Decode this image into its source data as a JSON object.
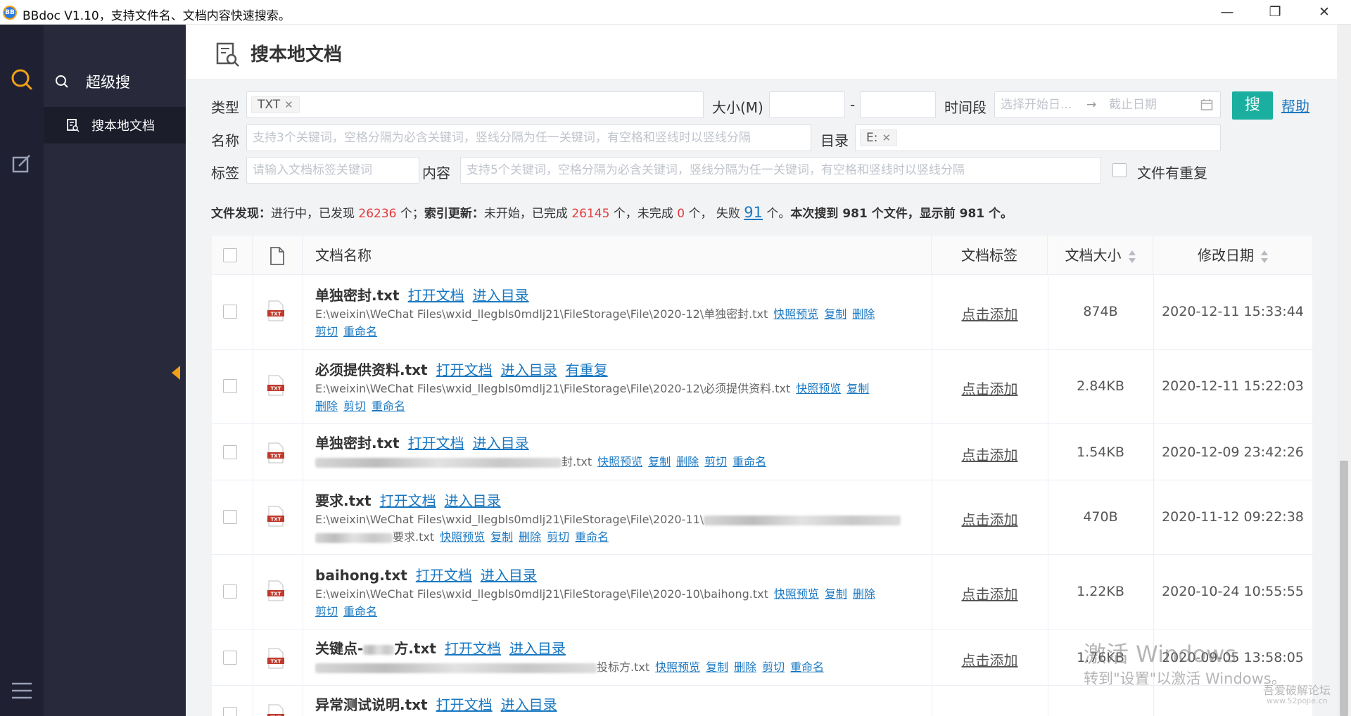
{
  "window": {
    "logo": "BB",
    "title": "BBdoc V1.10，支持文件名、文档内容快速搜索。",
    "minimize": "—",
    "maximize": "❐",
    "close": "✕"
  },
  "nav": {
    "header": "超级搜",
    "items": [
      {
        "label": "搜本地文档"
      }
    ]
  },
  "page": {
    "title": "搜本地文档"
  },
  "filters": {
    "type_label": "类型",
    "type_tag": "TXT",
    "size_label": "大小(M)",
    "size_sep": "-",
    "time_label": "时间段",
    "time_start_placeholder": "选择开始日...",
    "time_arrow": "→",
    "time_end_placeholder": "截止日期",
    "search_button": "搜",
    "help_link": "帮助",
    "name_label": "名称",
    "name_placeholder": "支持3个关键词，空格分隔为必含关键词，竖线分隔为任一关键词，有空格和竖线时以竖线分隔",
    "dir_label": "目录",
    "dir_tag": "E:",
    "tag_label": "标签",
    "tag_placeholder": "请输入文档标签关键词",
    "content_label": "内容",
    "content_placeholder": "支持5个关键词，空格分隔为必含关键词，竖线分隔为任一关键词，有空格和竖线时以竖线分隔",
    "duplicate_label": "文件有重复"
  },
  "status": {
    "discover_label": "文件发现：",
    "discover_text1": "进行中，已发现",
    "discover_count": "26236",
    "discover_text2": "个；",
    "index_label": "索引更新：",
    "index_text1": "未开始，已完成",
    "index_done": "26145",
    "index_text2": "个，未完成",
    "index_pending": "0",
    "index_text3": "个，  失败",
    "index_failed": "91",
    "index_text4": "个。",
    "summary": "本次搜到 981 个文件，显示前 981 个。"
  },
  "table": {
    "headers": {
      "name": "文档名称",
      "tag": "文档标签",
      "size": "文档大小",
      "date": "修改日期"
    },
    "actions": {
      "open": "打开文档",
      "enter": "进入目录",
      "duplicate": "有重复",
      "preview": "快照预览",
      "copy": "复制",
      "delete": "删除",
      "cut": "剪切",
      "rename": "重命名",
      "add_tag": "点击添加"
    },
    "rows": [
      {
        "name": "单独密封.txt",
        "path": "E:\\weixin\\WeChat Files\\wxid_llegbls0mdlj21\\FileStorage\\File\\2020-12\\单独密封.txt",
        "size": "874B",
        "date": "2020-12-11 15:33:44"
      },
      {
        "name": "必须提供资料.txt",
        "path": "E:\\weixin\\WeChat Files\\wxid_llegbls0mdlj21\\FileStorage\\File\\2020-12\\必须提供资料.txt",
        "size": "2.84KB",
        "date": "2020-12-11 15:22:03"
      },
      {
        "name": "单独密封.txt",
        "path_suffix": "封.txt",
        "size": "1.54KB",
        "date": "2020-12-09 23:42:26"
      },
      {
        "name": "要求.txt",
        "path": "E:\\weixin\\WeChat Files\\wxid_llegbls0mdlj21\\FileStorage\\File\\2020-11\\",
        "path_suffix": "要求.txt",
        "size": "470B",
        "date": "2020-11-12 09:22:38"
      },
      {
        "name": "baihong.txt",
        "path": "E:\\weixin\\WeChat Files\\wxid_llegbls0mdlj21\\FileStorage\\File\\2020-10\\baihong.txt",
        "size": "1.22KB",
        "date": "2020-10-24 10:55:55"
      },
      {
        "name_prefix": "关键点-",
        "name_suffix": "方.txt",
        "path_suffix": "投标方.txt",
        "size": "1.76KB",
        "date": "2020-09-05 13:58:05"
      },
      {
        "name": "异常测试说明.txt"
      }
    ]
  },
  "watermark": {
    "line1": "激活 Windows",
    "line2": "转到\"设置\"以激活 Windows。"
  },
  "forum": {
    "line1": "吾爱破解论坛",
    "line2": "www.52pojie.cn"
  },
  "colors": {
    "accent": "#1aaf9e",
    "link": "#1a78c2",
    "highlight": "#e23b3b",
    "rail": "#1f2132",
    "nav": "#282a3b",
    "logo_orange": "#f0a019"
  },
  "icons": [
    "search-icon",
    "edit-icon",
    "menu-icon",
    "doc-search-icon",
    "file-icon",
    "txt-file-icon",
    "calendar-icon",
    "collapse-arrow-icon"
  ]
}
